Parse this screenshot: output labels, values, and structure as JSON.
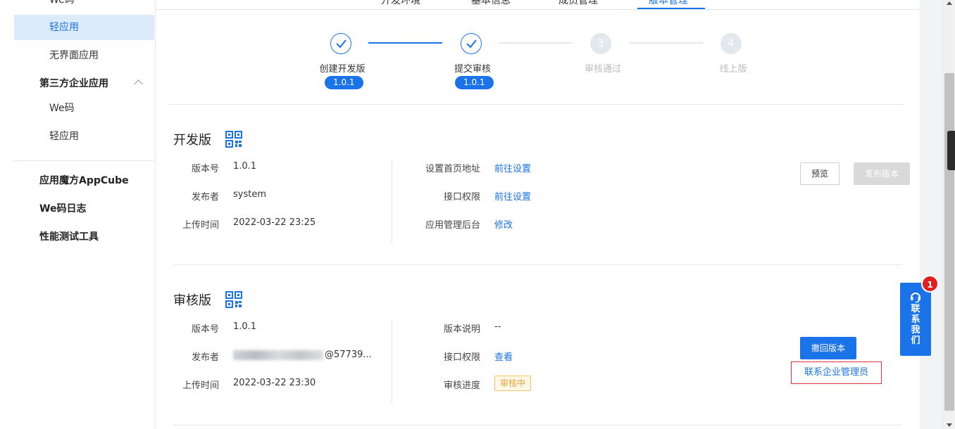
{
  "sidebar": {
    "items": [
      {
        "label": "We码"
      },
      {
        "label": "轻应用"
      },
      {
        "label": "无界面应用"
      },
      {
        "label": "第三方企业应用"
      },
      {
        "label": "We码"
      },
      {
        "label": "轻应用"
      },
      {
        "label": "应用魔方AppCube"
      },
      {
        "label": "We码日志"
      },
      {
        "label": "性能测试工具"
      }
    ]
  },
  "tabs": [
    {
      "label": "开发环境"
    },
    {
      "label": "基本信息"
    },
    {
      "label": "成员管理"
    },
    {
      "label": "版本管理"
    }
  ],
  "steps": [
    {
      "label": "创建开发版",
      "version": "1.0.1",
      "number": "",
      "done": true
    },
    {
      "label": "提交审核",
      "version": "1.0.1",
      "number": "",
      "done": true
    },
    {
      "label": "审核通过",
      "number": "3",
      "done": false
    },
    {
      "label": "线上版",
      "number": "4",
      "done": false
    }
  ],
  "dev": {
    "title": "开发版",
    "fields": [
      {
        "label": "版本号",
        "value": "1.0.1"
      },
      {
        "label": "发布者",
        "value": "system"
      },
      {
        "label": "上传时间",
        "value": "2022-03-22 23:25"
      }
    ],
    "right_fields": [
      {
        "label": "设置首页地址",
        "link": "前往设置"
      },
      {
        "label": "接口权限",
        "link": "前往设置"
      },
      {
        "label": "应用管理后台",
        "link": "修改"
      }
    ],
    "preview_label": "预览",
    "publish_label": "发布版本"
  },
  "review": {
    "title": "审核版",
    "fields": [
      {
        "label": "版本号",
        "value": "1.0.1"
      },
      {
        "label": "发布者",
        "value": "@57739..."
      },
      {
        "label": "上传时间",
        "value": "2022-03-22 23:30"
      }
    ],
    "right_fields": [
      {
        "label": "版本说明",
        "value": "--"
      },
      {
        "label": "接口权限",
        "link": "查看"
      },
      {
        "label": "审核进度",
        "badge": "审核中"
      }
    ],
    "withdraw_label": "撤回版本",
    "contact_admin_label": "联系企业管理员"
  },
  "float_contact": {
    "label": "联系我们",
    "chars": [
      "联",
      "系",
      "我",
      "们"
    ],
    "badge": "1"
  },
  "colors": {
    "accent": "#1a73e8",
    "active_bg": "#dcebfb",
    "danger": "#e02020",
    "warning": "#e6a23c"
  }
}
